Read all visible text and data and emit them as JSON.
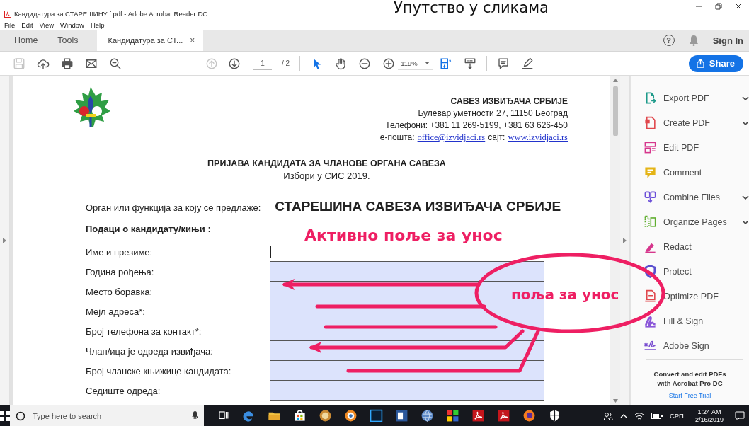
{
  "overlay_caption": "Упутство у сликама",
  "window": {
    "title": "Кандидатура за СТАРЕШИНУ f.pdf - Adobe Acrobat Reader DC"
  },
  "menu": [
    "File",
    "Edit",
    "View",
    "Window",
    "Help"
  ],
  "tabs": [
    {
      "label": "Home",
      "selected": false
    },
    {
      "label": "Tools",
      "selected": false
    },
    {
      "label": "Кандидатура за СТ...",
      "selected": true,
      "close": "×"
    }
  ],
  "account": {
    "help": "?",
    "sign_in": "Sign In"
  },
  "toolbar": {
    "file_tools": [
      {
        "kind": "save",
        "disabled": true
      },
      {
        "kind": "upload",
        "disabled": false
      },
      {
        "kind": "print",
        "disabled": false
      },
      {
        "kind": "mail",
        "disabled": false
      },
      {
        "kind": "find",
        "disabled": false
      }
    ],
    "page_nav": [
      {
        "kind": "prev",
        "disabled": true
      },
      {
        "kind": "next",
        "disabled": false
      }
    ],
    "page": "1",
    "page_total": "/ 2",
    "modes": [
      {
        "kind": "select",
        "selected": true
      },
      {
        "kind": "hand",
        "selected": false
      }
    ],
    "zoom_tools": [
      {
        "kind": "zoom_out"
      },
      {
        "kind": "zoom_in"
      }
    ],
    "zoom": "119%",
    "view_tools": [
      {
        "kind": "fit"
      },
      {
        "kind": "scroll"
      }
    ],
    "markup_tools": [
      {
        "kind": "comment"
      },
      {
        "kind": "pen"
      }
    ],
    "share": "Share"
  },
  "document": {
    "org": {
      "name": "САВЕЗ ИЗВИЂАЧА СРБИЈЕ",
      "address": "Булевар уметности 27, 11150 Београд",
      "phones": "Телефони: +381 11 269-5199, +381 63 626-450",
      "email_label": "е-пошта:",
      "email": "office@izvidjaci.rs",
      "site_label": "сајт:",
      "site": "www.izvidjaci.rs"
    },
    "title": "ПРИЈАВА КАНДИДАТА ЗА ЧЛАНОВЕ ОРГАНА САВЕЗА",
    "subtitle": "Избори у СИС 2019.",
    "position_label": "Орган или функција за коју се предлаже:",
    "position_value": "СТАРЕШИНА САВЕЗА ИЗВИЂАЧА СРБИЈЕ",
    "section": "Подаци о кандидату/кињи :",
    "fields": [
      {
        "label": "Име и презиме:",
        "active": true
      },
      {
        "label": "Година рођења:",
        "active": false
      },
      {
        "label": "Место боравка:",
        "active": false
      },
      {
        "label": "Мејл адреса*:",
        "active": false
      },
      {
        "label": "Број телефона за контакт*:",
        "active": false
      },
      {
        "label": "Члан/ица је одреда извиђача:",
        "active": false
      },
      {
        "label": "Број чланске књижице кандидата:",
        "active": false
      },
      {
        "label": "Седиште одреда:",
        "active": false
      }
    ]
  },
  "annotations": {
    "caption": "Активно поље за унос",
    "bubble": "поља за унос"
  },
  "tools_panel": {
    "items": [
      {
        "label": "Export PDF",
        "kind": "export",
        "color": "#1d9a8a",
        "has_menu": true
      },
      {
        "label": "Create PDF",
        "kind": "create",
        "color": "#e0474c",
        "has_menu": true
      },
      {
        "label": "Edit PDF",
        "kind": "edit",
        "color": "#d6368c",
        "has_menu": false
      },
      {
        "label": "Comment",
        "kind": "comment",
        "color": "#e4b416",
        "has_menu": false
      },
      {
        "label": "Combine Files",
        "kind": "combine",
        "color": "#6b4fd8",
        "has_menu": true
      },
      {
        "label": "Organize Pages",
        "kind": "organize",
        "color": "#5fae2e",
        "has_menu": true
      },
      {
        "label": "Redact",
        "kind": "redact",
        "color": "#d6368c",
        "has_menu": false
      },
      {
        "label": "Protect",
        "kind": "protect",
        "color": "#5a4fcf",
        "has_menu": false
      },
      {
        "label": "Optimize PDF",
        "kind": "optimize",
        "color": "#e0474c",
        "has_menu": false
      },
      {
        "label": "Fill & Sign",
        "kind": "fill_sign",
        "color": "#8a56d8",
        "has_menu": false
      },
      {
        "label": "Adobe Sign",
        "kind": "sign",
        "color": "#7a4fd0",
        "has_menu": false
      }
    ],
    "promo": "Convert and edit PDFs with Acrobat Pro DC",
    "trial": "Start Free Trial"
  },
  "taskbar": {
    "search_placeholder": "Type here to search",
    "apps": [
      {
        "kind": "taskview"
      },
      {
        "kind": "edge"
      },
      {
        "kind": "explorer"
      },
      {
        "kind": "store"
      },
      {
        "kind": "orb"
      },
      {
        "kind": "gear"
      },
      {
        "kind": "ps"
      },
      {
        "kind": "word"
      },
      {
        "kind": "globe"
      },
      {
        "kind": "tiles"
      },
      {
        "kind": "acrobat"
      },
      {
        "kind": "acrobat"
      },
      {
        "kind": "firefox"
      },
      {
        "kind": "shield"
      }
    ],
    "language": "СРП",
    "time": "1:24 AM",
    "date": "2/16/2019"
  }
}
